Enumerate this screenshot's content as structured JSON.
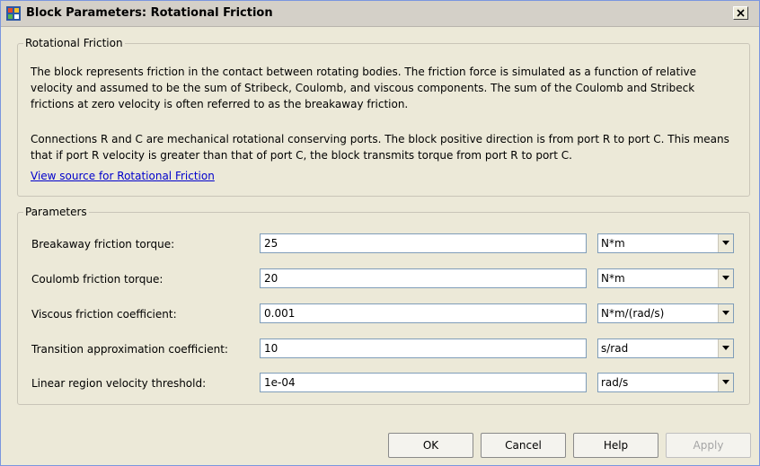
{
  "window": {
    "title": "Block Parameters: Rotational Friction"
  },
  "description_section": {
    "legend": "Rotational Friction",
    "paragraph1_lines": [
      "The block represents friction in the contact between rotating bodies. The friction force is simulated as a function of relative",
      "velocity and assumed to be the sum of Stribeck, Coulomb, and viscous components. The sum of the Coulomb and Stribeck",
      "frictions at zero velocity is often referred to as the breakaway friction."
    ],
    "paragraph2_lines": [
      "Connections R and C are mechanical rotational conserving ports. The block positive direction is from port R to port C. This means",
      "that if port R velocity is greater than that of port C, the block transmits torque from port R to port C."
    ],
    "link": "View source for Rotational Friction"
  },
  "parameters": {
    "legend": "Parameters",
    "rows": [
      {
        "label": "Breakaway friction torque:",
        "value": "25",
        "unit": "N*m"
      },
      {
        "label": "Coulomb friction torque:",
        "value": "20",
        "unit": "N*m"
      },
      {
        "label": "Viscous friction coefficient:",
        "value": "0.001",
        "unit": "N*m/(rad/s)"
      },
      {
        "label": "Transition approximation coefficient:",
        "value": "10",
        "unit": "s/rad"
      },
      {
        "label": "Linear region velocity threshold:",
        "value": "1e-04",
        "unit": "rad/s"
      }
    ]
  },
  "buttons": {
    "ok": "OK",
    "cancel": "Cancel",
    "help": "Help",
    "apply": "Apply"
  },
  "icons": {
    "app": "simulink-block-icon",
    "close": "close-icon",
    "dropdown": "chevron-down-icon"
  }
}
